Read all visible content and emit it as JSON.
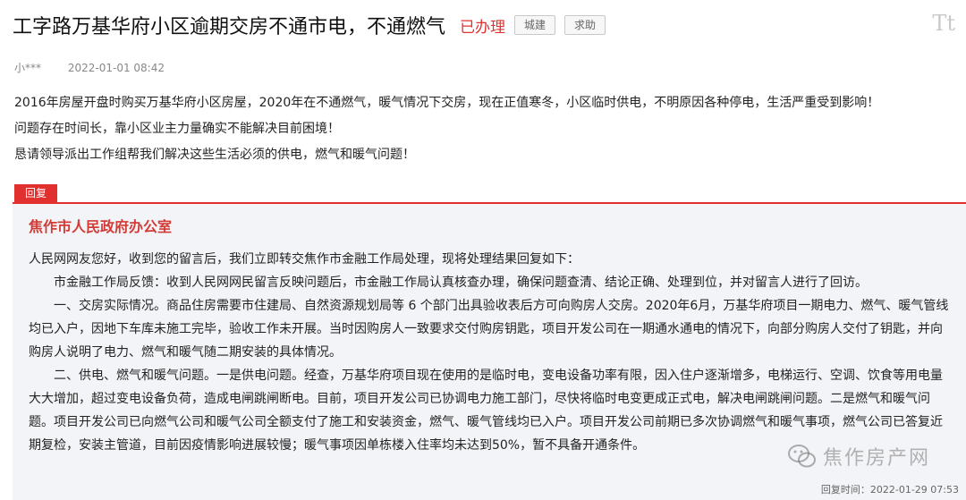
{
  "message": {
    "title": "工字路万基华府小区逾期交房不通市电，不通燃气",
    "status": "已办理",
    "tags": [
      "城建",
      "求助"
    ],
    "author": "小***",
    "date": "2022-01-01 08:42",
    "paragraphs": [
      "2016年房屋开盘时购买万基华府小区房屋，2020年在不通燃气，暖气情况下交房，现在正值寒冬，小区临时供电，不明原因各种停电，生活严重受到影响！",
      "问题存在时间长，靠小区业主力量确实不能解决目前困境！",
      "恳请领导派出工作组帮我们解决这些生活必须的供电，燃气和暖气问题！"
    ]
  },
  "font_tool": "Tt",
  "reply": {
    "badge": "回复",
    "org": "焦作市人民政府办公室",
    "paragraphs": [
      "人民网网友您好，收到您的留言后，我们立即转交焦作市金融工作局处理，现将处理结果回复如下：",
      "市金融工作局反馈：收到人民网网民留言反映问题后，市金融工作局认真核查办理，确保问题查清、结论正确、处理到位，并对留言人进行了回访。",
      "一、交房实际情况。商品住房需要市住建局、自然资源规划局等 6 个部门出具验收表后方可向购房人交房。2020年6月，万基华府项目一期电力、燃气、暖气管线均已入户，因地下车库未施工完毕，验收工作未开展。当时因购房人一致要求交付购房钥匙，项目开发公司在一期通水通电的情况下，向部分购房人交付了钥匙，并向购房人说明了电力、燃气和暖气随二期安装的具体情况。",
      "二、供电、燃气和暖气问题。一是供电问题。经查，万基华府项目现在使用的是临时电，变电设备功率有限，因入住户逐渐增多，电梯运行、空调、饮食等用电量大大增加，超过变电设备负荷，造成电闸跳闸断电。目前，项目开发公司已协调电力施工部门，尽快将临时电变更成正式电，解决电闸跳闸问题。二是燃气和暖气问题。项目开发公司已向燃气公司和暖气公司全额支付了施工和安装资金，燃气、暖气管线均已入户。项目开发公司前期已多次协调燃气和暖气事项，燃气公司已答复近期复检，安装主管道，目前因疫情影响进展较慢；暖气事项因单栋楼入住率均未达到50%，暂不具备开通条件。"
    ],
    "time_label": "回复时间：",
    "time": "2022-01-29 07:53"
  },
  "watermark": {
    "text": "焦作房产网",
    "icon": "wechat-icon"
  }
}
